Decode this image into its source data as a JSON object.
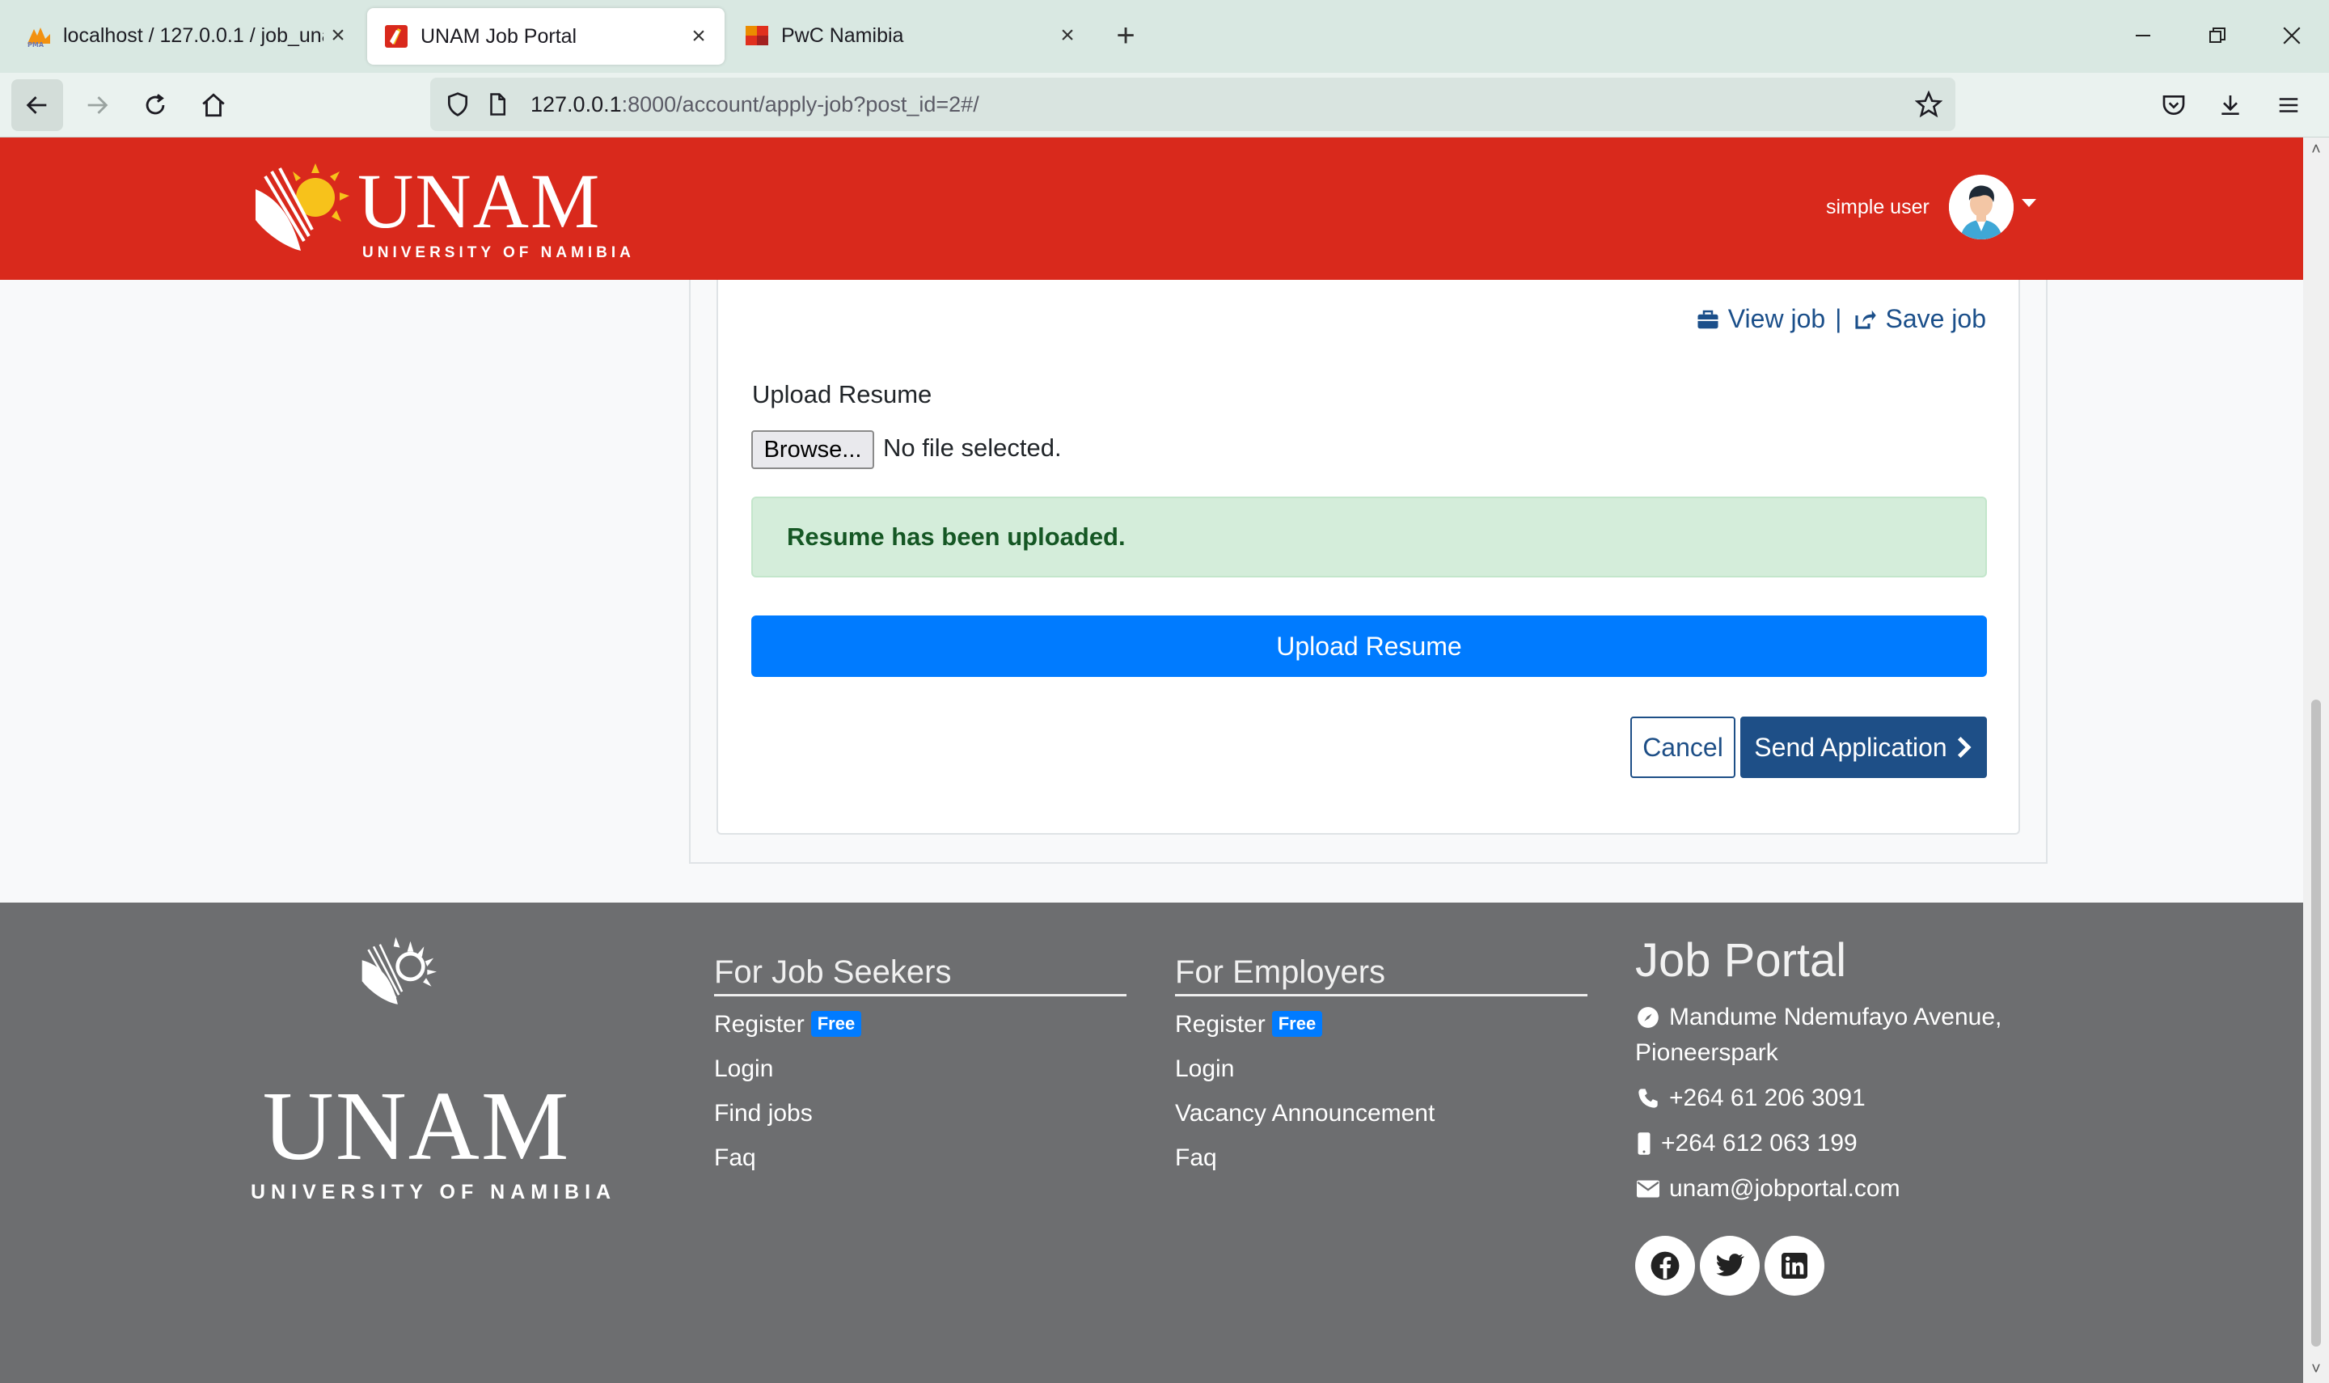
{
  "browser": {
    "tabs": [
      {
        "title": "localhost / 127.0.0.1 / job_unam",
        "favicon": "phpmyadmin-icon"
      },
      {
        "title": "UNAM Job Portal",
        "favicon": "unam-favicon",
        "active": true
      },
      {
        "title": "PwC Namibia",
        "favicon": "pwc-favicon"
      }
    ],
    "url_host": "127.0.0.1",
    "url_path": ":8000/account/apply-job?post_id=2#/"
  },
  "header": {
    "logo_word": "UNAM",
    "logo_sub": "UNIVERSITY OF NAMIBIA",
    "user_name": "simple user"
  },
  "job_actions": {
    "view_job": "View job",
    "separator": "|",
    "save_job": "Save job"
  },
  "upload": {
    "label": "Upload Resume",
    "browse_label": "Browse...",
    "file_status": "No file selected.",
    "alert": "Resume has been uploaded.",
    "upload_button": "Upload Resume"
  },
  "actions": {
    "cancel": "Cancel",
    "send": "Send Application"
  },
  "footer": {
    "logo_word": "UNAM",
    "logo_sub": "UNIVERSITY OF NAMIBIA",
    "job_seekers": {
      "title": "For Job Seekers",
      "links": [
        "Register",
        "Login",
        "Find jobs",
        "Faq"
      ],
      "badge": "Free"
    },
    "employers": {
      "title": "For Employers",
      "links": [
        "Register",
        "Login",
        "Vacancy Announcement",
        "Faq"
      ],
      "badge": "Free"
    },
    "portal": {
      "title": "Job Portal",
      "address_line1": "Mandume Ndemufayo Avenue,",
      "address_line2": "Pioneerspark",
      "phone": "+264 61 206 3091",
      "mobile": "+264 612 063 199",
      "email": "unam@jobportal.com"
    },
    "social": [
      "facebook-icon",
      "twitter-icon",
      "linkedin-icon"
    ]
  },
  "colors": {
    "header_red": "#d9291c",
    "primary_blue": "#007bff",
    "navy": "#1e4f87",
    "footer_gray": "#6d6e70",
    "success_bg": "#d4edda",
    "success_text": "#155724"
  }
}
